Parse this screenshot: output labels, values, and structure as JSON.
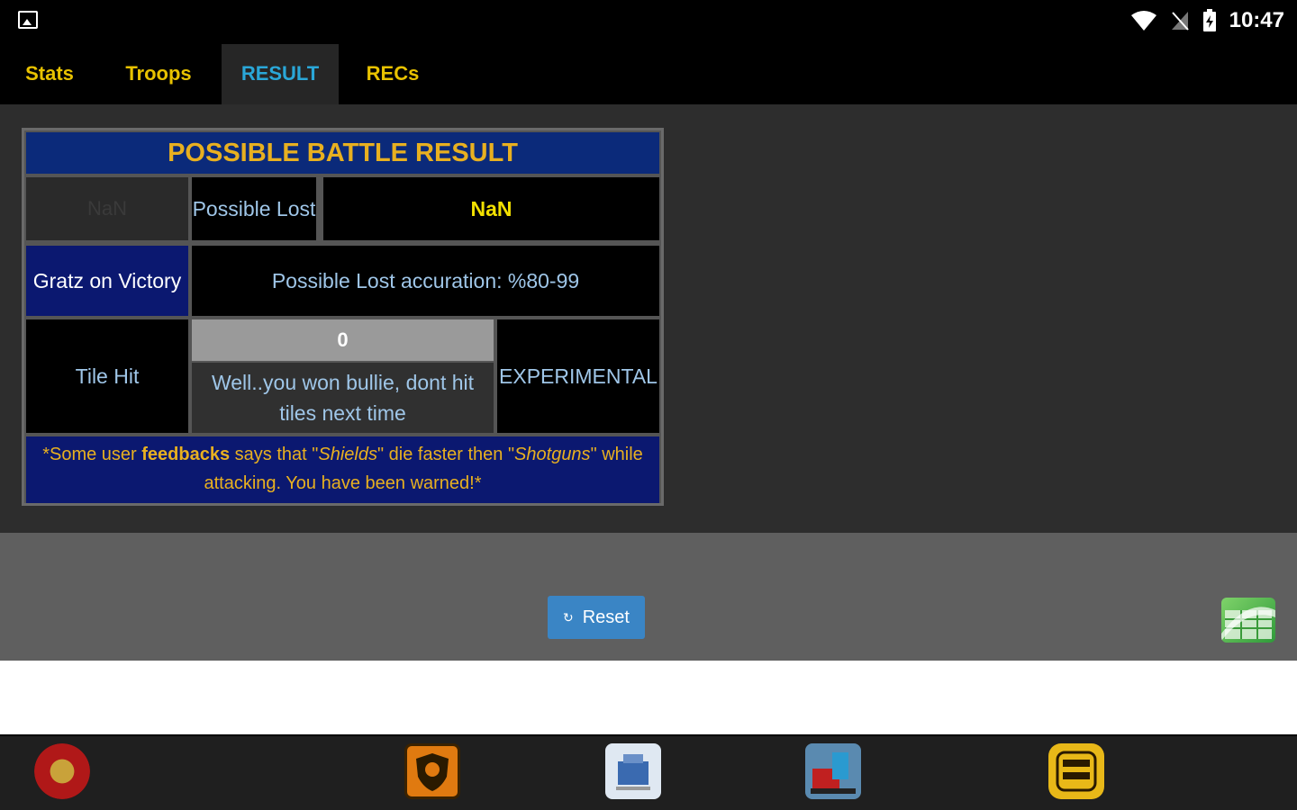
{
  "status_bar": {
    "time": "10:47",
    "icons": [
      "image-icon",
      "wifi-icon",
      "no-signal-icon",
      "battery-charging-icon"
    ]
  },
  "tabs": [
    {
      "label": "Stats",
      "active": false
    },
    {
      "label": "Troops",
      "active": false
    },
    {
      "label": "RESULT",
      "active": true
    },
    {
      "label": "RECs",
      "active": false
    }
  ],
  "result": {
    "title": "POSSIBLE BATTLE RESULT",
    "row1": {
      "left": "NaN",
      "middle": "Possible Lost",
      "right": "NaN"
    },
    "row2": {
      "left": "Gratz on Victory",
      "right": "Possible Lost accuration: %80-99"
    },
    "row3": {
      "left": "Tile Hit",
      "value": "0",
      "message": "Well..you won bullie, dont hit tiles next time",
      "right": "EXPERIMENTAL"
    },
    "note": {
      "part1": "*Some user ",
      "bold": "feedbacks",
      "part2": " says that \"",
      "italic1": "Shields",
      "part3": "\" die faster then \"",
      "italic2": "Shotguns",
      "part4": "\" while attacking. You have been warned!*"
    }
  },
  "footer": {
    "reset_label": "Reset",
    "reset_icon": "refresh-icon",
    "sheet_icon": "spreadsheet-icon"
  },
  "bottom_apps": [
    "clan-badge-app-icon",
    "shield-emblem-app-icon",
    "blue-building-app-icon",
    "red-robot-app-icon",
    "coc-lab-app-icon"
  ],
  "colors": {
    "tab_text": "#e8c200",
    "tab_active": "#2aa7d8",
    "header_bg": "#0b2a7a",
    "header_text": "#e8b020",
    "cell_text": "#9fc6e8",
    "yellow_value": "#f2e000",
    "reset_bg": "#3a85c5"
  }
}
